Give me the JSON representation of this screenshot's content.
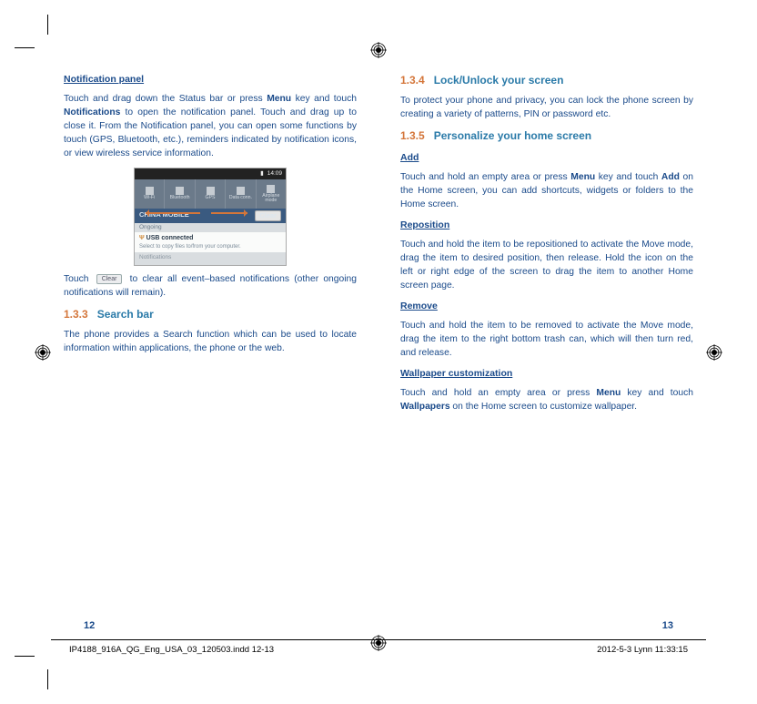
{
  "left_page": {
    "h_notif_panel": "Notification panel",
    "p_notif_1": "Touch and drag down the Status bar or press ",
    "p_notif_1b": "Menu",
    "p_notif_1c": " key and touch ",
    "p_notif_1d": "Notifications",
    "p_notif_1e": " to open the notification panel. Touch and drag up to close it. From the Notification panel, you can open some functions by touch (GPS, Bluetooth, etc.), reminders indicated by notification icons, or view wireless service information.",
    "fig": {
      "status_time": "14:09",
      "qs": [
        "Wi-Fi",
        "Bluetooth",
        "GPS",
        "Data conn.",
        "Airplane mode"
      ],
      "carrier": "CHINA MOBILE",
      "clear": "Clear",
      "ongoing": "Ongoing",
      "usb_title": "USB connected",
      "usb_sub": "Select to copy files to/from your computer.",
      "notifications": "Notifications"
    },
    "p_touch_a": "Touch ",
    "p_touch_clear": "Clear",
    "p_touch_b": " to clear all event–based notifications (other ongoing notifications will remain).",
    "h_133_num": "1.3.3",
    "h_133": "Search bar",
    "p_133": "The phone provides a Search function which can be used to locate information within applications, the phone or the web.",
    "page_no": "12"
  },
  "right_page": {
    "h_134_num": "1.3.4",
    "h_134": "Lock/Unlock your screen",
    "p_134": "To protect your phone and privacy, you can lock the phone screen by creating a variety of patterns, PIN or password etc.",
    "h_135_num": "1.3.5",
    "h_135": "Personalize your home screen",
    "h_add": "Add",
    "p_add_a": "Touch and hold an empty area or press ",
    "p_add_b": "Menu",
    "p_add_c": " key and touch ",
    "p_add_d": "Add",
    "p_add_e": " on the Home screen, you can add shortcuts, widgets or folders to the Home screen.",
    "h_repo": "Reposition",
    "p_repo": "Touch and hold the item to be repositioned to activate the Move mode, drag the item to desired position, then release. Hold the icon on the left or right edge of the screen to drag the item to another Home screen page.",
    "h_remove": "Remove",
    "p_remove": "Touch and hold the item to be removed to activate the Move mode, drag the item to the right bottom trash can, which will then turn red, and release.",
    "h_wall": "Wallpaper customization",
    "p_wall_a": "Touch and hold an empty area or press ",
    "p_wall_b": "Menu",
    "p_wall_c": " key and touch ",
    "p_wall_d": "Wallpapers",
    "p_wall_e": " on the Home screen to customize wallpaper.",
    "page_no": "13"
  },
  "footer": {
    "file": "IP4188_916A_QG_Eng_USA_03_120503.indd   12-13",
    "stamp": "2012-5-3   Lynn 11:33:15"
  }
}
